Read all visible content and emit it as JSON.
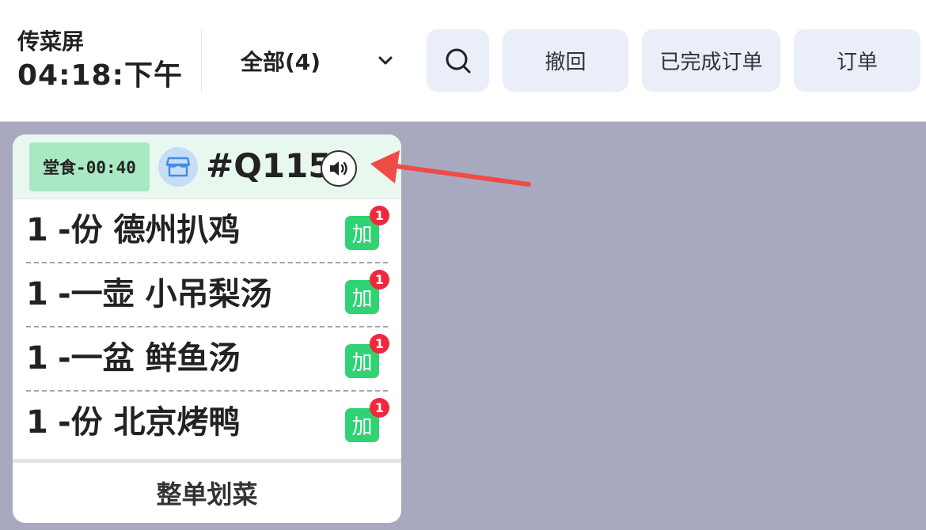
{
  "header": {
    "title": "传菜屏",
    "time": "04:18:下午",
    "filter": {
      "label": "全部(4)",
      "icon": "chevron-down-icon"
    },
    "buttons": {
      "search_icon": "search-icon",
      "undo": "撤回",
      "completed_orders": "已完成订单",
      "orders": "订单"
    }
  },
  "order_card": {
    "tag": "堂食-00:40",
    "store_icon": "store-icon",
    "order_number": "#Q115",
    "speaker_icon": "speaker-icon",
    "items": [
      {
        "qty": "1",
        "unit": "-份",
        "name": "德州扒鸡",
        "badge": "加",
        "count": "1"
      },
      {
        "qty": "1",
        "unit": "-一壶",
        "name": "小吊梨汤",
        "badge": "加",
        "count": "1"
      },
      {
        "qty": "1",
        "unit": "-一盆",
        "name": "鲜鱼汤",
        "badge": "加",
        "count": "1"
      },
      {
        "qty": "1",
        "unit": "-份",
        "name": "北京烤鸭",
        "badge": "加",
        "count": "1"
      }
    ],
    "footer_button": "整单划菜"
  },
  "colors": {
    "board_background": "#a8a9bf",
    "card_header": "#e9f8ee",
    "tag_background": "#a8e9c4",
    "add_badge": "#2fd373",
    "count_badge": "#f0283c",
    "button_background": "#eaeef9",
    "annotation_arrow": "#ef4b48"
  }
}
